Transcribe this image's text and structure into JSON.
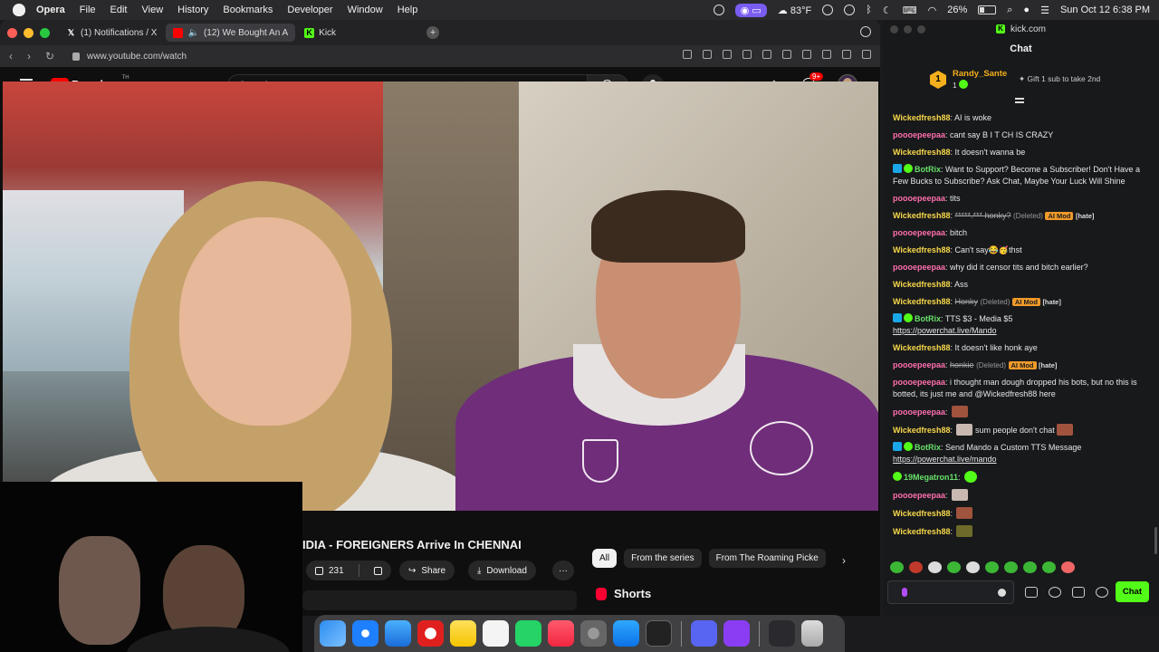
{
  "menubar": {
    "app": "Opera",
    "items": [
      "File",
      "Edit",
      "View",
      "History",
      "Bookmarks",
      "Developer",
      "Window",
      "Help"
    ],
    "weather": "83°F",
    "battery": "26%",
    "datetime": "Sun Oct 12  6:38 PM"
  },
  "browser": {
    "tabs": [
      {
        "label": "(1) Notifications / X",
        "icon": "x-logo-icon"
      },
      {
        "label": "(12) We Bought An A",
        "icon": "youtube-icon"
      },
      {
        "label": "Kick",
        "icon": "kick-logo-icon"
      }
    ],
    "url": "www.youtube.com/watch"
  },
  "youtube": {
    "brand": "Premium",
    "brand_sup": "TH",
    "search_placeholder": "Search",
    "notifications_badge": "9+",
    "video_title": "IDIA - FOREIGNERS Arrive In CHENNAI",
    "likes": "231",
    "share_label": "Share",
    "download_label": "Download",
    "more_label": "···",
    "chips": [
      "All",
      "From the series",
      "From The Roaming Picke"
    ],
    "shorts_label": "Shorts"
  },
  "kick": {
    "window_title": "kick.com",
    "chat_title": "Chat",
    "pinned": {
      "user": "Randy_Sante",
      "rank": "1",
      "count": "1",
      "gift_text": "Gift 1 sub to take 2nd"
    },
    "send_label": "Chat"
  },
  "chat": [
    {
      "user": "Wickedfresh88",
      "color": "yellow",
      "text": "AI is woke"
    },
    {
      "user": "poooepeepaa",
      "color": "pink",
      "text": "cant say B I T CH IS CRAZY"
    },
    {
      "user": "Wickedfresh88",
      "color": "yellow",
      "text": "It doesn't wanna be"
    },
    {
      "user": "BotRix",
      "color": "green",
      "badges": true,
      "text": "Want to Support? Become a Subscriber! Don't Have a Few Bucks to Subscribe? Ask Chat, Maybe Your Luck Will Shine"
    },
    {
      "user": "poooepeepaa",
      "color": "pink",
      "text": "tits"
    },
    {
      "user": "Wickedfresh88",
      "color": "yellow",
      "deleted": "*****.*** honky?",
      "del_tag": "(Deleted)",
      "mod": "AI Mod",
      "hate": "[hate]"
    },
    {
      "user": "poooepeepaa",
      "color": "pink",
      "text": "bitch"
    },
    {
      "user": "Wickedfresh88",
      "color": "yellow",
      "text": "Can't say😂🥳thst"
    },
    {
      "user": "poooepeepaa",
      "color": "pink",
      "text": "why did it censor tits and bitch earlier?"
    },
    {
      "user": "Wickedfresh88",
      "color": "yellow",
      "text": "Ass"
    },
    {
      "user": "Wickedfresh88",
      "color": "yellow",
      "deleted": "Honky",
      "del_tag": "(Deleted)",
      "mod": "AI Mod",
      "hate": "[hate]"
    },
    {
      "user": "BotRix",
      "color": "green",
      "badges": true,
      "text": "TTS $3 - Media $5",
      "link": "https://powerchat.live/Mando"
    },
    {
      "user": "Wickedfresh88",
      "color": "yellow",
      "text": "It doesn't like honk aye"
    },
    {
      "user": "poooepeepaa",
      "color": "pink",
      "deleted": "honkie",
      "del_tag": "(Deleted)",
      "mod": "AI Mod",
      "hate": "[hate]"
    },
    {
      "user": "poooepeepaa",
      "color": "pink",
      "text": "i thought man dough dropped his bots, but no this is botted, its just me and @Wickedfresh88 here"
    },
    {
      "user": "poooepeepaa",
      "color": "pink",
      "emote": "brown"
    },
    {
      "user": "Wickedfresh88",
      "color": "yellow",
      "text": "sum people don't chat",
      "emote_before": "grey",
      "emote": "brown"
    },
    {
      "user": "BotRix",
      "color": "green",
      "badges": true,
      "text": "Send Mando a Custom TTS Message",
      "link": "https://powerchat.live/mando"
    },
    {
      "user": "19Megatron11",
      "color": "green",
      "gift_badge": true,
      "emote": "green"
    },
    {
      "user": "poooepeepaa",
      "color": "pink",
      "emote": "grey"
    },
    {
      "user": "Wickedfresh88",
      "color": "yellow",
      "emote": "brown"
    },
    {
      "user": "Wickedfresh88",
      "color": "yellow",
      "emote": "olive"
    }
  ],
  "colors": {
    "kick_green": "#53fc18",
    "yt_red": "#ff0000",
    "user_yellow": "#f7d84a",
    "user_pink": "#ff6fae",
    "user_green": "#67e06a"
  }
}
